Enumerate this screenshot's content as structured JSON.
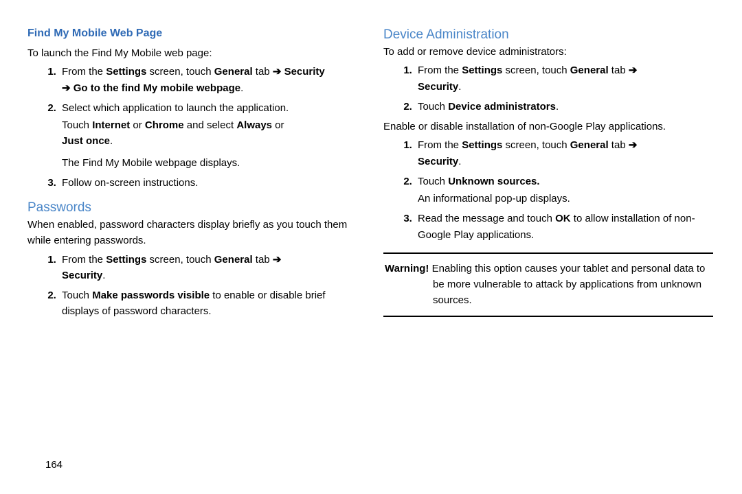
{
  "left": {
    "h_find": "Find My Mobile Web Page",
    "intro_find": "To launch the Find My Mobile web page:",
    "find_steps": {
      "s1_a": "From the ",
      "s1_b": "Settings",
      "s1_c": " screen, touch ",
      "s1_d": "General",
      "s1_e": " tab ",
      "s1_f": "➔",
      "s1_g": " Security ",
      "s1_h": "➔ Go to the find My mobile webpage",
      "s1_i": ".",
      "s2_a": "Select which application to launch the application.",
      "s2_b": "Touch ",
      "s2_c": "Internet",
      "s2_d": " or ",
      "s2_e": "Chrome",
      "s2_f": " and select ",
      "s2_g": "Always",
      "s2_h": " or ",
      "s2_i": "Just once",
      "s2_j": ".",
      "s2_k": "The Find My Mobile webpage displays.",
      "s3": "Follow on-screen instructions."
    },
    "h_pass": "Passwords",
    "intro_pass": "When enabled, password characters display briefly as you touch them while entering passwords.",
    "pass_steps": {
      "s1_a": "From the ",
      "s1_b": "Settings",
      "s1_c": " screen, touch ",
      "s1_d": "General",
      "s1_e": " tab ",
      "s1_f": "➔",
      "s1_g": "Security",
      "s1_h": ".",
      "s2_a": "Touch ",
      "s2_b": "Make passwords visible",
      "s2_c": " to enable or disable brief displays of password characters."
    }
  },
  "right": {
    "h_dev": "Device Administration",
    "intro_dev": "To add or remove device administrators:",
    "dev_steps": {
      "s1_a": "From the ",
      "s1_b": "Settings",
      "s1_c": " screen, touch ",
      "s1_d": "General",
      "s1_e": " tab ",
      "s1_f": "➔",
      "s1_g": "Security",
      "s1_h": ".",
      "s2_a": "Touch ",
      "s2_b": "Device administrators",
      "s2_c": "."
    },
    "intro_unk": "Enable or disable installation of non-Google Play applications.",
    "unk_steps": {
      "s1_a": "From the ",
      "s1_b": "Settings",
      "s1_c": " screen, touch ",
      "s1_d": "General",
      "s1_e": " tab ",
      "s1_f": "➔",
      "s1_g": "Security",
      "s1_h": ".",
      "s2_a": "Touch ",
      "s2_b": "Unknown sources.",
      "s2_c": "An informational pop-up displays.",
      "s3_a": "Read the message and touch ",
      "s3_b": "OK",
      "s3_c": " to allow installation of non-Google Play applications."
    },
    "warn_label": "Warning!",
    "warn_text": " Enabling this option causes your tablet and personal data to be more vulnerable to attack by applications from unknown sources."
  },
  "page_number": "164"
}
